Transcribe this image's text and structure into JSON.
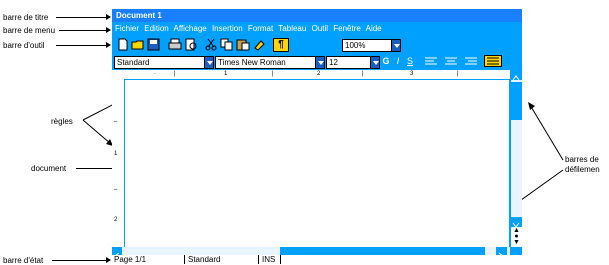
{
  "annotations": {
    "title_bar": "barre de titre",
    "menu_bar": "barre de menu",
    "tool_bar": "barre d'outil",
    "rulers": "règles",
    "document": "document",
    "scrollbars_line1": "barres de",
    "scrollbars_line2": "défilemen",
    "status_bar": "barre d'état"
  },
  "window": {
    "title": "Document 1"
  },
  "menu": [
    "Fichier",
    "Edition",
    "Affichage",
    "Insertion",
    "Format",
    "Tableau",
    "Outil",
    "Fenêtre",
    "Aide"
  ],
  "toolbar": {
    "icons": [
      "new-document-icon",
      "open-folder-icon",
      "save-icon",
      "print-icon",
      "print-preview-icon",
      "cut-icon",
      "copy-icon",
      "paste-icon",
      "format-painter-icon",
      "pilcrow-icon"
    ],
    "zoom": "100%"
  },
  "format_bar": {
    "style": "Standard",
    "font": "Times New Roman",
    "size": "12",
    "bold": "G",
    "italic": "I",
    "underline": "S"
  },
  "ruler": {
    "h_labels": [
      "1",
      "2",
      "3"
    ],
    "v_labels": [
      "1",
      "2"
    ]
  },
  "status": {
    "page": "Page 1/1",
    "style": "Standard",
    "mode": "INS"
  },
  "colors": {
    "window_bg": "#00a0ff",
    "title_bg": "#1880ff",
    "accent": "#1a5fbf"
  }
}
